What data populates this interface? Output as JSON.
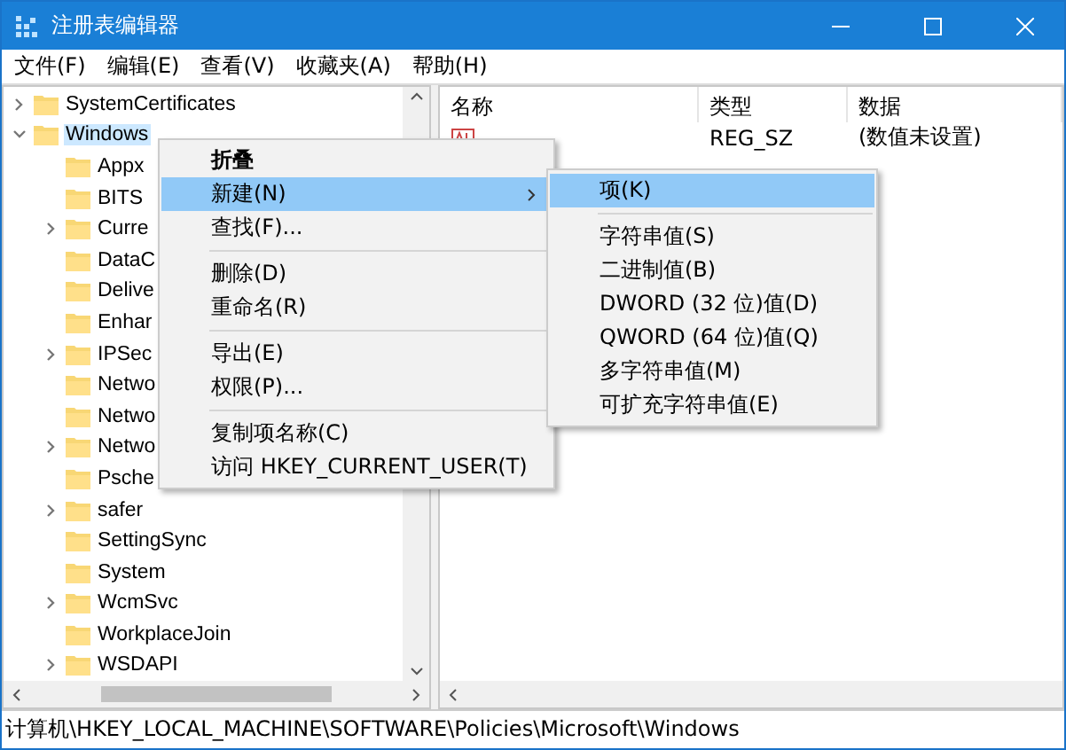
{
  "window": {
    "title": "注册表编辑器"
  },
  "menu": [
    "文件(F)",
    "编辑(E)",
    "查看(V)",
    "收藏夹(A)",
    "帮助(H)"
  ],
  "tree": [
    {
      "label": "SystemCertificates",
      "expandable": true,
      "expanded": false,
      "selected": false
    },
    {
      "label": "Windows",
      "expandable": true,
      "expanded": true,
      "selected": true,
      "children": [
        {
          "label": "Appx",
          "expandable": false,
          "selected": false
        },
        {
          "label": "BITS",
          "expandable": false,
          "selected": false
        },
        {
          "label": "Curre",
          "expandable": true,
          "expanded": false,
          "selected": false
        },
        {
          "label": "DataC",
          "expandable": false,
          "selected": false
        },
        {
          "label": "Delive",
          "expandable": false,
          "selected": false
        },
        {
          "label": "Enhar",
          "expandable": false,
          "selected": false
        },
        {
          "label": "IPSec",
          "expandable": true,
          "expanded": false,
          "selected": false
        },
        {
          "label": "Netwo",
          "expandable": false,
          "selected": false
        },
        {
          "label": "Netwo",
          "expandable": false,
          "selected": false
        },
        {
          "label": "Netwo",
          "expandable": true,
          "expanded": false,
          "selected": false
        },
        {
          "label": "Psche",
          "expandable": false,
          "selected": false
        },
        {
          "label": "safer",
          "expandable": true,
          "expanded": false,
          "selected": false
        },
        {
          "label": "SettingSync",
          "expandable": false,
          "selected": false
        },
        {
          "label": "System",
          "expandable": false,
          "selected": false
        },
        {
          "label": "WcmSvc",
          "expandable": true,
          "expanded": false,
          "selected": false
        },
        {
          "label": "WorkplaceJoin",
          "expandable": false,
          "selected": false
        },
        {
          "label": "WSDAPI",
          "expandable": true,
          "expanded": false,
          "selected": false
        }
      ]
    }
  ],
  "table": {
    "columns": [
      "名称",
      "类型",
      "数据"
    ],
    "rows": [
      {
        "type": "REG_SZ",
        "data": "(数值未设置)"
      }
    ]
  },
  "context_menu": [
    {
      "kind": "item",
      "label": "折叠",
      "bold": true,
      "selected": false
    },
    {
      "kind": "submenu",
      "label": "新建(N)",
      "bold": false,
      "selected": true
    },
    {
      "kind": "item",
      "label": "查找(F)...",
      "bold": false,
      "selected": false
    },
    {
      "kind": "separator"
    },
    {
      "kind": "item",
      "label": "删除(D)",
      "bold": false,
      "selected": false
    },
    {
      "kind": "item",
      "label": "重命名(R)",
      "bold": false,
      "selected": false
    },
    {
      "kind": "separator"
    },
    {
      "kind": "item",
      "label": "导出(E)",
      "bold": false,
      "selected": false
    },
    {
      "kind": "item",
      "label": "权限(P)...",
      "bold": false,
      "selected": false
    },
    {
      "kind": "separator"
    },
    {
      "kind": "item",
      "label": "复制项名称(C)",
      "bold": false,
      "selected": false
    },
    {
      "kind": "item",
      "label": "访问 HKEY_CURRENT_USER(T)",
      "bold": false,
      "selected": false
    }
  ],
  "submenu": [
    {
      "kind": "item",
      "label": "项(K)",
      "selected": true
    },
    {
      "kind": "separator"
    },
    {
      "kind": "item",
      "label": "字符串值(S)",
      "selected": false
    },
    {
      "kind": "item",
      "label": "二进制值(B)",
      "selected": false
    },
    {
      "kind": "item",
      "label": "DWORD (32 位)值(D)",
      "selected": false
    },
    {
      "kind": "item",
      "label": "QWORD (64 位)值(Q)",
      "selected": false
    },
    {
      "kind": "item",
      "label": "多字符串值(M)",
      "selected": false
    },
    {
      "kind": "item",
      "label": "可扩充字符串值(E)",
      "selected": false
    }
  ],
  "status_bar": "计算机\\HKEY_LOCAL_MACHINE\\SOFTWARE\\Policies\\Microsoft\\Windows"
}
